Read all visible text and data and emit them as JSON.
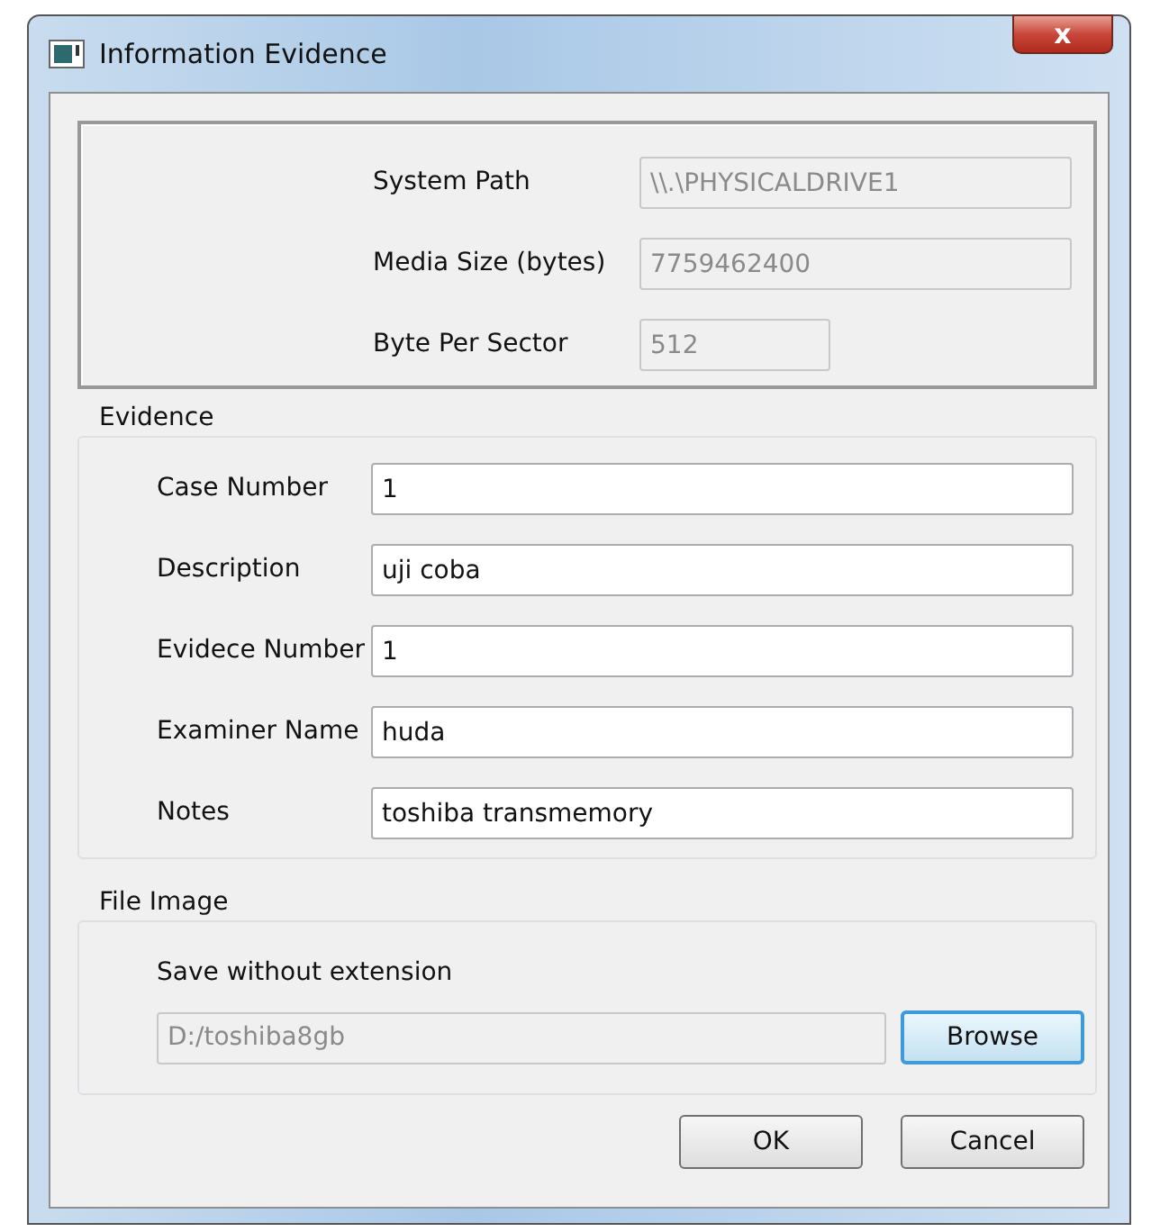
{
  "window": {
    "title": "Information Evidence",
    "close": "x"
  },
  "device": {
    "fields": [
      {
        "label": "System Path",
        "value": "\\\\.\\PHYSICALDRIVE1",
        "disabled": true,
        "kind": "wide"
      },
      {
        "label": "Media Size (bytes)",
        "value": "7759462400",
        "disabled": true,
        "kind": "wide"
      },
      {
        "label": "Byte Per Sector",
        "value": "512",
        "disabled": true,
        "kind": "short"
      }
    ]
  },
  "evidence": {
    "title": "Evidence",
    "fields": [
      {
        "label": "Case Number",
        "value": "1",
        "disabled": false
      },
      {
        "label": "Description",
        "value": "uji coba",
        "disabled": false
      },
      {
        "label": "Evidece Number",
        "value": "1",
        "disabled": false
      },
      {
        "label": "Examiner Name",
        "value": "huda",
        "disabled": false
      },
      {
        "label": "Notes",
        "value": "toshiba transmemory",
        "disabled": false
      }
    ]
  },
  "file_image": {
    "title": "File Image",
    "hint": "Save without extension",
    "path": {
      "value": "D:/toshiba8gb",
      "disabled": true
    },
    "browse": {
      "label": "Browse",
      "focused": true
    }
  },
  "buttons": [
    {
      "label": "OK",
      "focused": false
    },
    {
      "label": "Cancel",
      "focused": false
    }
  ]
}
